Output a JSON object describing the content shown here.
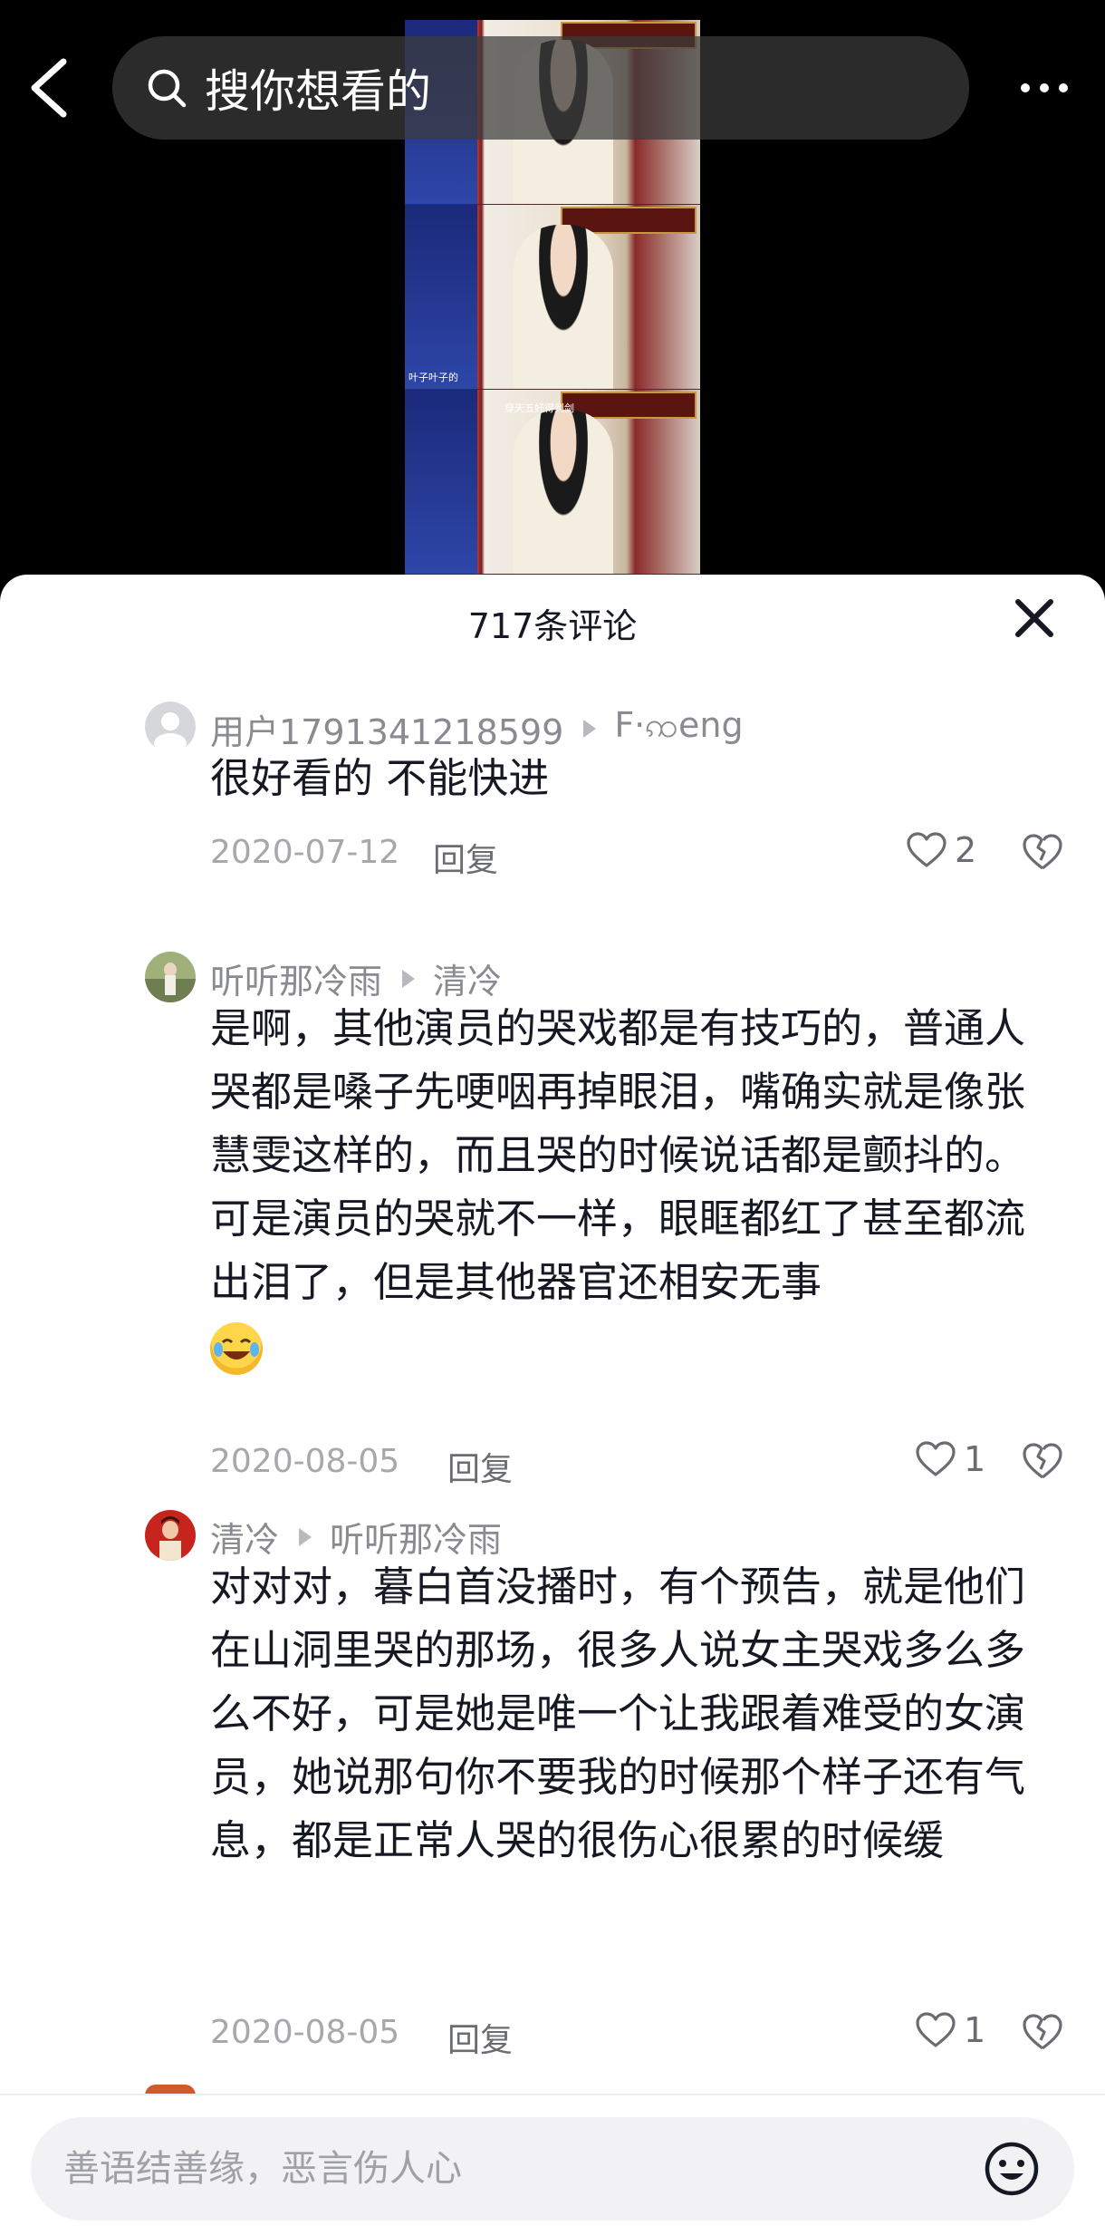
{
  "header": {
    "search_text": "搜你想看的",
    "back_icon": "chevron-left-icon",
    "more_icon": "more-dots-icon"
  },
  "video": {
    "overlay_sub_1": "叶子叶子的",
    "overlay_sub_2": "穿天五好得到剑"
  },
  "comments_sheet": {
    "title": "717条评论",
    "close_icon": "close-icon",
    "comments": [
      {
        "user": "用户1791341218599",
        "reply_to": "F·ꩡeng",
        "text": "很好看的 不能快进",
        "date": "2020-07-12",
        "reply_label": "回复",
        "likes": "2"
      },
      {
        "user": "听听那冷雨",
        "reply_to": "清冷",
        "text": "是啊，其他演员的哭戏都是有技巧的，普通人哭都是嗓子先哽咽再掉眼泪，嘴确实就是像张慧雯这样的，而且哭的时候说话都是颤抖的。可是演员的哭就不一样，眼眶都红了甚至都流出泪了，但是其他器官还相安无事",
        "date": "2020-08-05",
        "reply_label": "回复",
        "likes": "1"
      },
      {
        "user": "清冷",
        "reply_to": "听听那冷雨",
        "text": "对对对，暮白首没播时，有个预告，就是他们在山洞里哭的那场，很多人说女主哭戏多么多么不好，可是她是唯一个让我跟着难受的女演员，她说那句你不要我的时候那个样子还有气息，都是正常人哭的很伤心很累的时候缓",
        "date": "2020-08-05",
        "reply_label": "回复",
        "likes": "1"
      }
    ]
  },
  "input": {
    "placeholder": "善语结善缘，恶言伤人心",
    "emoji_icon": "emoji-smile-icon"
  },
  "colors": {
    "sheet_bg": "#ffffff",
    "text_primary": "#161823",
    "text_secondary": "#8a8b91",
    "meta": "#a7a8ac"
  }
}
